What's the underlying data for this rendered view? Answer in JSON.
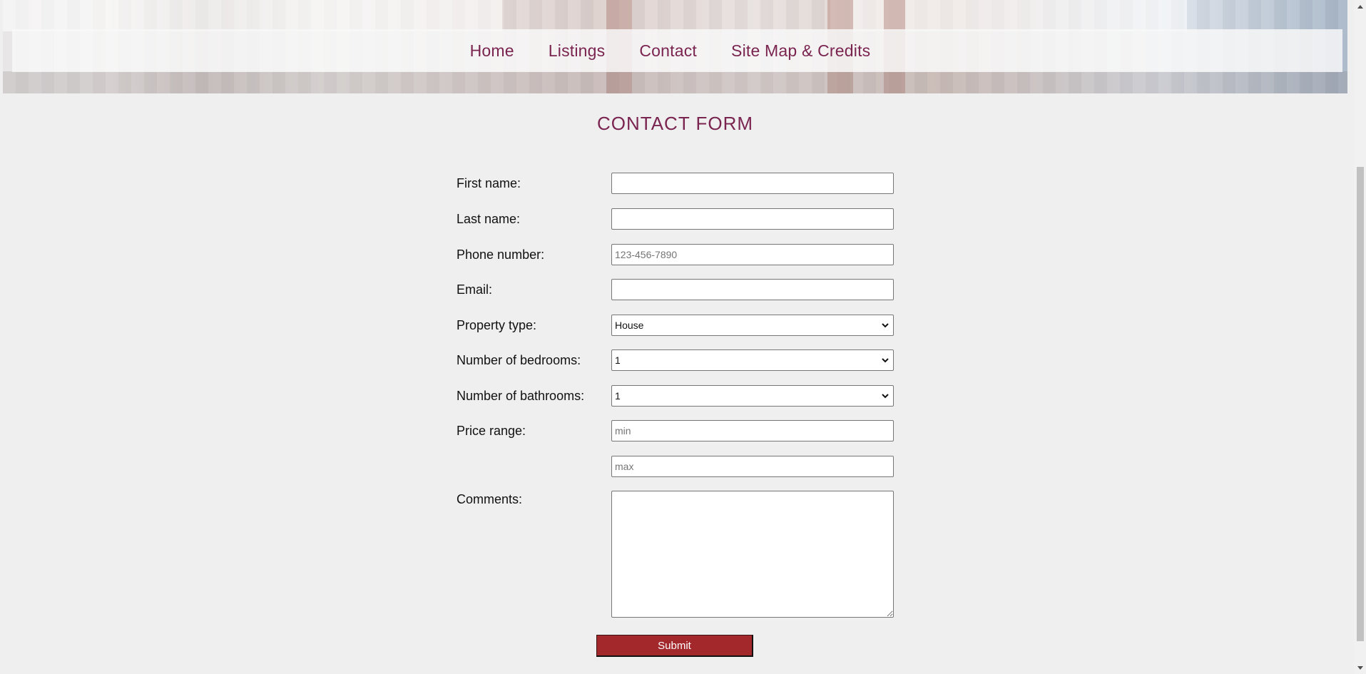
{
  "nav": {
    "items": [
      {
        "label": "Home"
      },
      {
        "label": "Listings"
      },
      {
        "label": "Contact"
      },
      {
        "label": "Site Map & Credits"
      }
    ]
  },
  "page": {
    "title": "CONTACT FORM"
  },
  "form": {
    "first_name": {
      "label": "First name:",
      "value": "",
      "placeholder": ""
    },
    "last_name": {
      "label": "Last name:",
      "value": "",
      "placeholder": ""
    },
    "phone": {
      "label": "Phone number:",
      "value": "",
      "placeholder": "123-456-7890"
    },
    "email": {
      "label": "Email:",
      "value": "",
      "placeholder": ""
    },
    "property_type": {
      "label": "Property type:",
      "selected": "House"
    },
    "bedrooms": {
      "label": "Number of bedrooms:",
      "selected": "1"
    },
    "bathrooms": {
      "label": "Number of bathrooms:",
      "selected": "1"
    },
    "price_range": {
      "label": "Price range:",
      "min_placeholder": "min",
      "max_placeholder": "max"
    },
    "comments": {
      "label": "Comments:",
      "value": ""
    },
    "submit_label": "Submit"
  },
  "colors": {
    "accent": "#7a2450",
    "submit_bg": "#a3282c",
    "page_bg": "#efefef"
  }
}
